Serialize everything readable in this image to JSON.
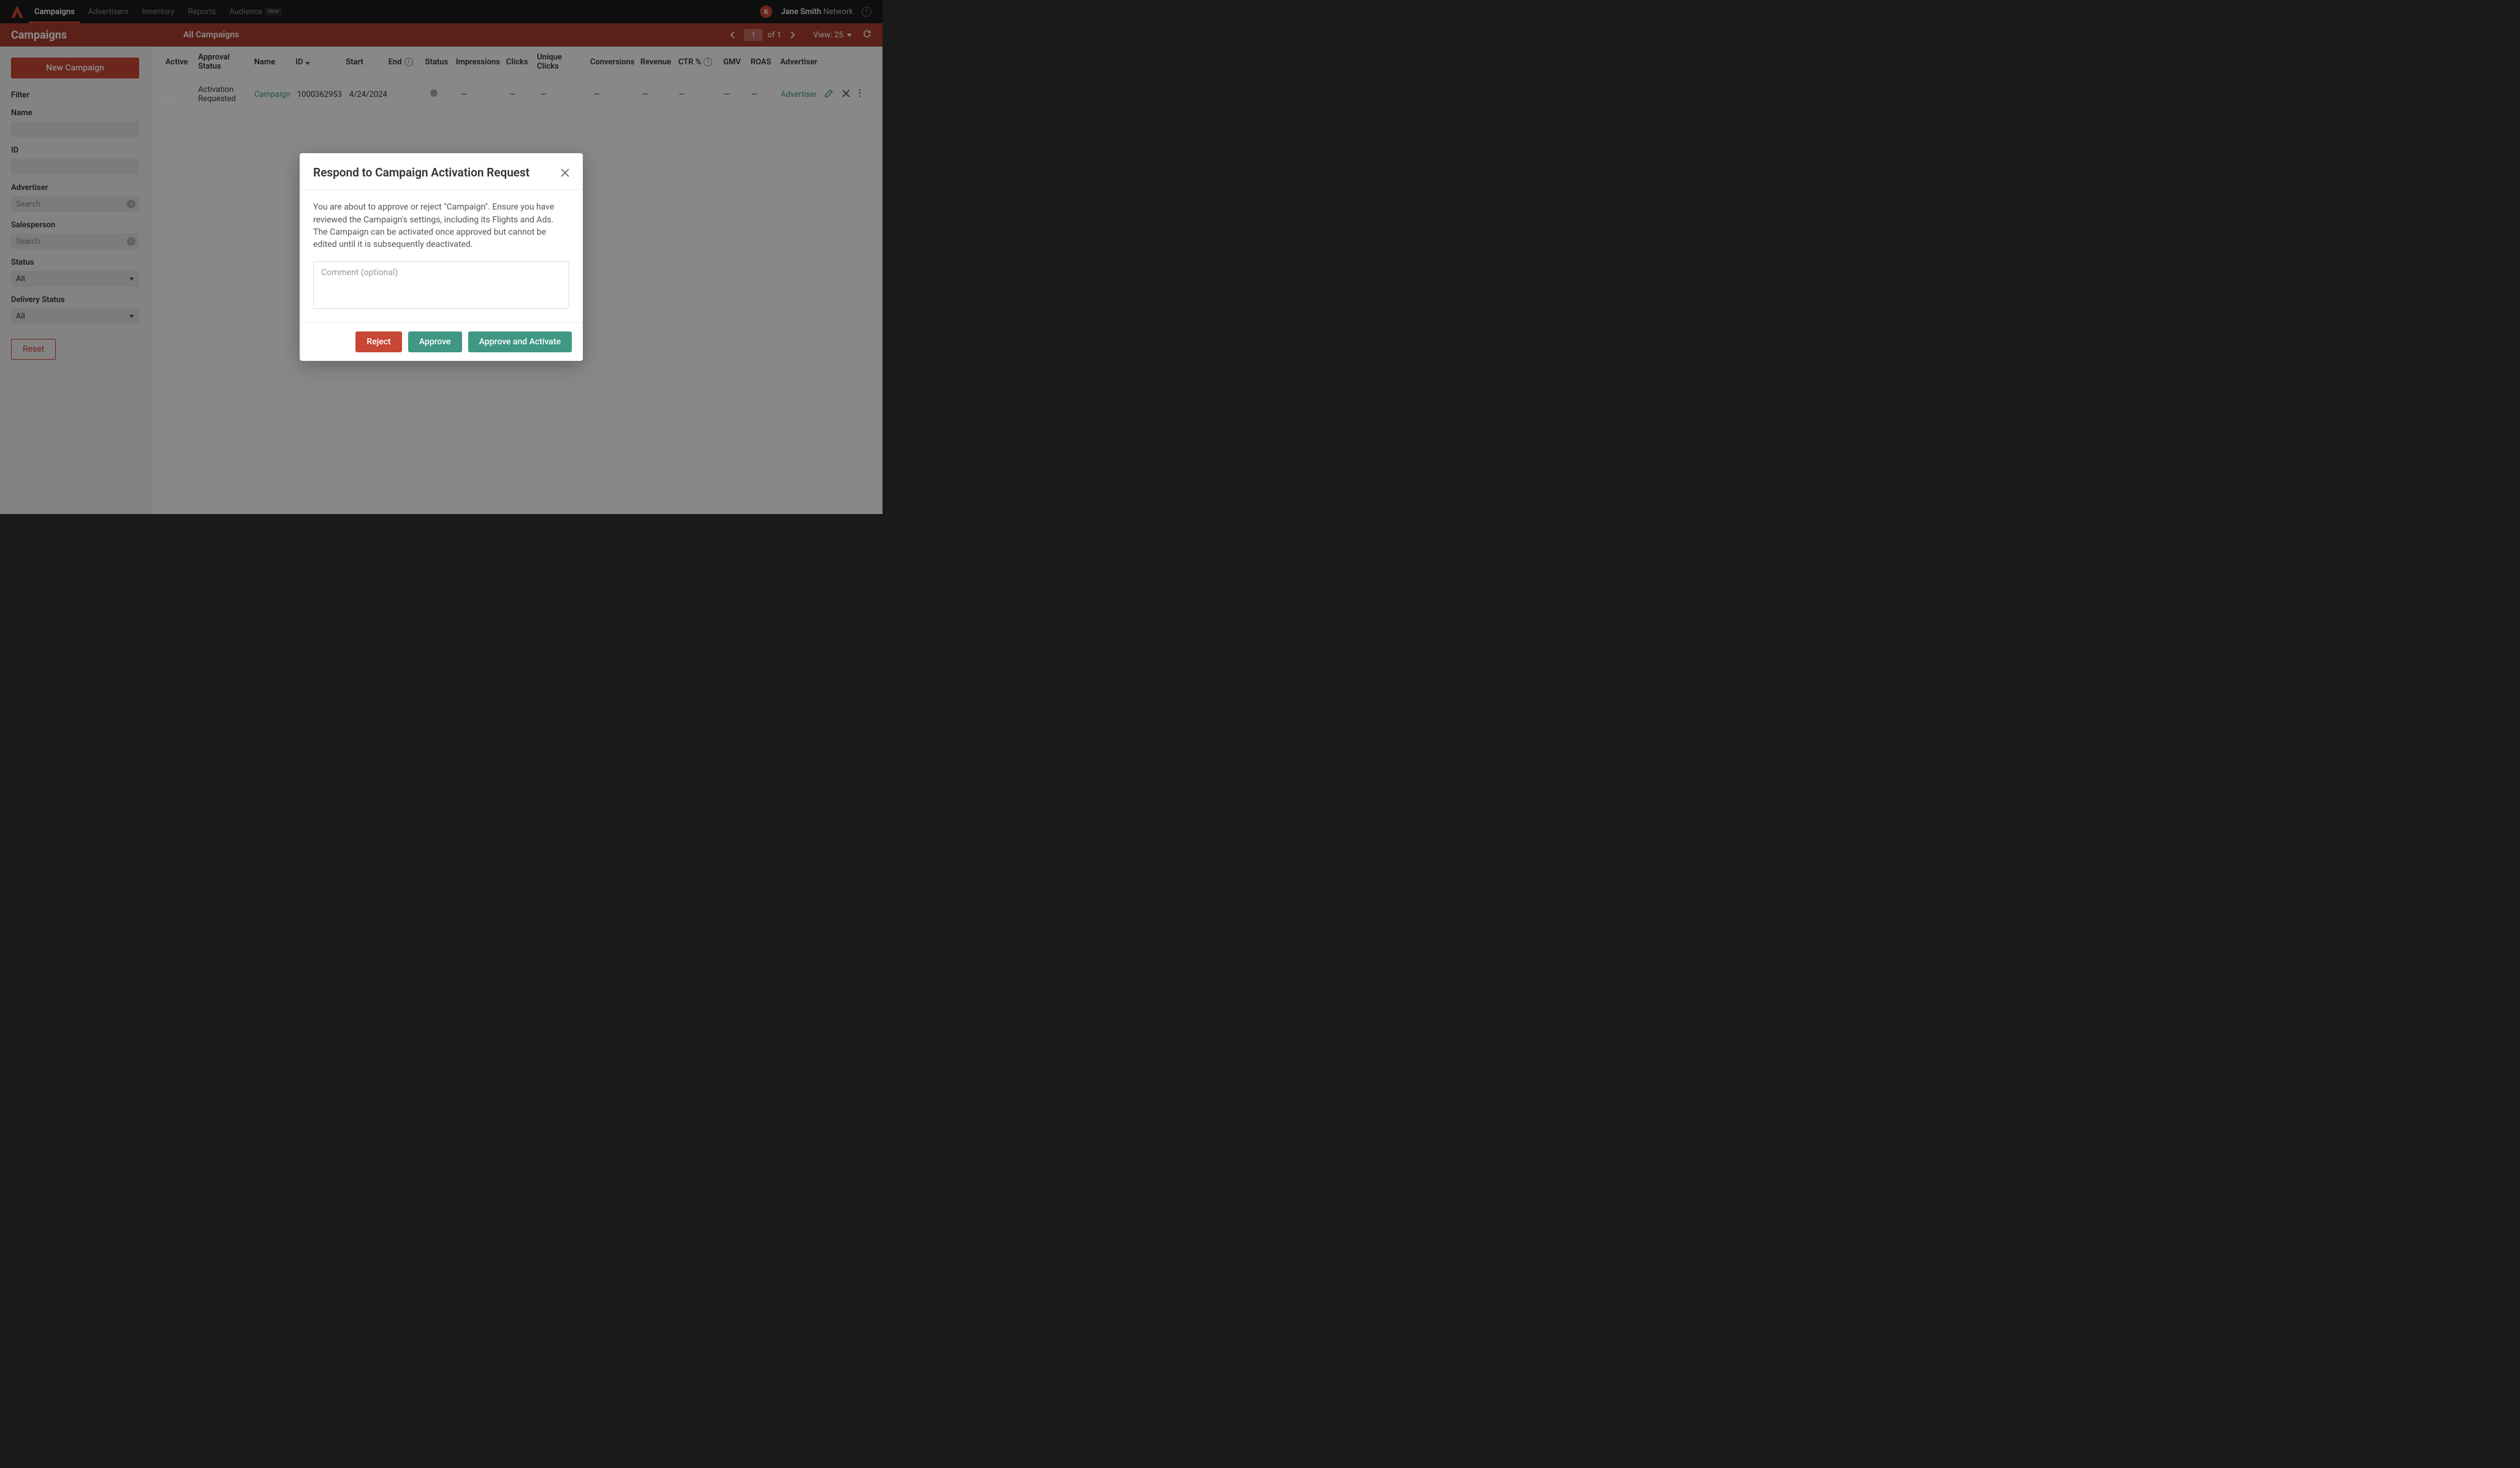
{
  "nav": {
    "items": [
      "Campaigns",
      "Advertisers",
      "Inventory",
      "Reports",
      "Audience"
    ],
    "audience_tag": "New",
    "avatar_initial": "K",
    "user_bold": "Jane Smith",
    "user_light": "Network"
  },
  "header": {
    "title": "Campaigns",
    "crumb": "All Campaigns",
    "page_value": "1",
    "page_total": "of 1",
    "view_label": "View: 25"
  },
  "sidebar": {
    "new_btn": "New Campaign",
    "filter_title": "Filter",
    "labels": {
      "name": "Name",
      "id": "ID",
      "advertiser": "Advertiser",
      "salesperson": "Salesperson",
      "status": "Status",
      "delivery": "Delivery Status"
    },
    "search_placeholder": "Search",
    "status_value": "All",
    "delivery_value": "All",
    "reset": "Reset"
  },
  "table": {
    "headers": {
      "active": "Active",
      "approval": "Approval Status",
      "name": "Name",
      "id": "ID",
      "start": "Start",
      "end": "End",
      "status": "Status",
      "impressions": "Impressions",
      "clicks": "Clicks",
      "uclicks": "Unique Clicks",
      "conversions": "Conversions",
      "revenue": "Revenue",
      "ctr": "CTR %",
      "gmv": "GMV",
      "roas": "ROAS",
      "advertiser": "Advertiser"
    },
    "row": {
      "approval": "Activation Requested",
      "name": "Campaign",
      "id": "1000362953",
      "start": "4/24/2024",
      "end": "",
      "impressions": "—",
      "clicks": "—",
      "uclicks": "—",
      "conversions": "—",
      "revenue": "—",
      "ctr": "—",
      "gmv": "—",
      "roas": "—",
      "advertiser": "Advertiser"
    }
  },
  "modal": {
    "title": "Respond to Campaign Activation Request",
    "body": "You are about to approve or reject \"Campaign\". Ensure you have reviewed the Campaign's settings, including its Flights and Ads. The Campaign can be activated once approved but cannot be edited until it is subsequently deactivated.",
    "comment_placeholder": "Comment (optional)",
    "reject": "Reject",
    "approve": "Approve",
    "approve_activate": "Approve and Activate"
  }
}
